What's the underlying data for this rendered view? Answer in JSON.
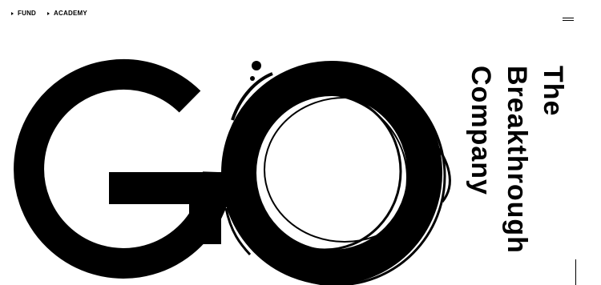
{
  "nav": {
    "items": [
      {
        "label": "FUND"
      },
      {
        "label": "ACADEMY"
      }
    ]
  },
  "hero": {
    "logo_letters": "GO",
    "tagline_lines": [
      "The",
      "Breakthrough",
      "Company"
    ]
  },
  "icons": {
    "menu": "hamburger-menu-icon",
    "nav_arrow": "triangle-right-icon"
  },
  "colors": {
    "background": "#ffffff",
    "foreground": "#000000"
  }
}
